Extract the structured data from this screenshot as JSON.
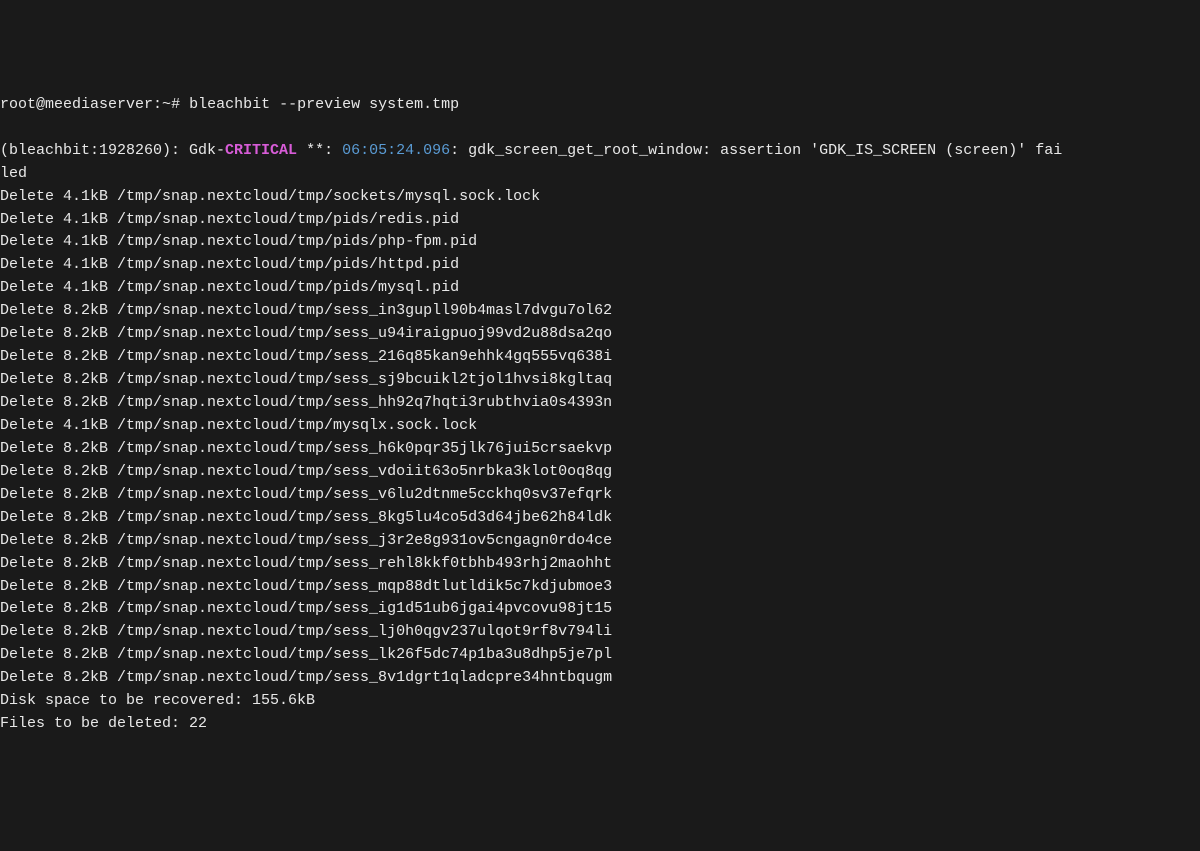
{
  "prompt": {
    "user_host": "root@meediaserver",
    "path": "~",
    "symbol": "#",
    "command": "bleachbit --preview system.tmp"
  },
  "error": {
    "prefix": "(bleachbit:1928260): Gdk-",
    "level": "CRITICAL",
    "stars": " **: ",
    "timestamp": "06:05:24.096",
    "message": ": gdk_screen_get_root_window: assertion 'GDK_IS_SCREEN (screen)' fai",
    "continuation": "led"
  },
  "deletions": [
    {
      "size": "4.1kB",
      "path": "/tmp/snap.nextcloud/tmp/sockets/mysql.sock.lock"
    },
    {
      "size": "4.1kB",
      "path": "/tmp/snap.nextcloud/tmp/pids/redis.pid"
    },
    {
      "size": "4.1kB",
      "path": "/tmp/snap.nextcloud/tmp/pids/php-fpm.pid"
    },
    {
      "size": "4.1kB",
      "path": "/tmp/snap.nextcloud/tmp/pids/httpd.pid"
    },
    {
      "size": "4.1kB",
      "path": "/tmp/snap.nextcloud/tmp/pids/mysql.pid"
    },
    {
      "size": "8.2kB",
      "path": "/tmp/snap.nextcloud/tmp/sess_in3gupll90b4masl7dvgu7ol62"
    },
    {
      "size": "8.2kB",
      "path": "/tmp/snap.nextcloud/tmp/sess_u94iraigpuoj99vd2u88dsa2qo"
    },
    {
      "size": "8.2kB",
      "path": "/tmp/snap.nextcloud/tmp/sess_216q85kan9ehhk4gq555vq638i"
    },
    {
      "size": "8.2kB",
      "path": "/tmp/snap.nextcloud/tmp/sess_sj9bcuikl2tjol1hvsi8kgltaq"
    },
    {
      "size": "8.2kB",
      "path": "/tmp/snap.nextcloud/tmp/sess_hh92q7hqti3rubthvia0s4393n"
    },
    {
      "size": "4.1kB",
      "path": "/tmp/snap.nextcloud/tmp/mysqlx.sock.lock"
    },
    {
      "size": "8.2kB",
      "path": "/tmp/snap.nextcloud/tmp/sess_h6k0pqr35jlk76jui5crsaekvp"
    },
    {
      "size": "8.2kB",
      "path": "/tmp/snap.nextcloud/tmp/sess_vdoiit63o5nrbka3klot0oq8qg"
    },
    {
      "size": "8.2kB",
      "path": "/tmp/snap.nextcloud/tmp/sess_v6lu2dtnme5cckhq0sv37efqrk"
    },
    {
      "size": "8.2kB",
      "path": "/tmp/snap.nextcloud/tmp/sess_8kg5lu4co5d3d64jbe62h84ldk"
    },
    {
      "size": "8.2kB",
      "path": "/tmp/snap.nextcloud/tmp/sess_j3r2e8g931ov5cngagn0rdo4ce"
    },
    {
      "size": "8.2kB",
      "path": "/tmp/snap.nextcloud/tmp/sess_rehl8kkf0tbhb493rhj2maohht"
    },
    {
      "size": "8.2kB",
      "path": "/tmp/snap.nextcloud/tmp/sess_mqp88dtlutldik5c7kdjubmoe3"
    },
    {
      "size": "8.2kB",
      "path": "/tmp/snap.nextcloud/tmp/sess_ig1d51ub6jgai4pvcovu98jt15"
    },
    {
      "size": "8.2kB",
      "path": "/tmp/snap.nextcloud/tmp/sess_lj0h0qgv237ulqot9rf8v794li"
    },
    {
      "size": "8.2kB",
      "path": "/tmp/snap.nextcloud/tmp/sess_lk26f5dc74p1ba3u8dhp5je7pl"
    },
    {
      "size": "8.2kB",
      "path": "/tmp/snap.nextcloud/tmp/sess_8v1dgrt1qladcpre34hntbqugm"
    }
  ],
  "summary": {
    "disk_space_label": "Disk space to be recovered: ",
    "disk_space_value": "155.6kB",
    "files_label": "Files to be deleted: ",
    "files_value": "22"
  }
}
